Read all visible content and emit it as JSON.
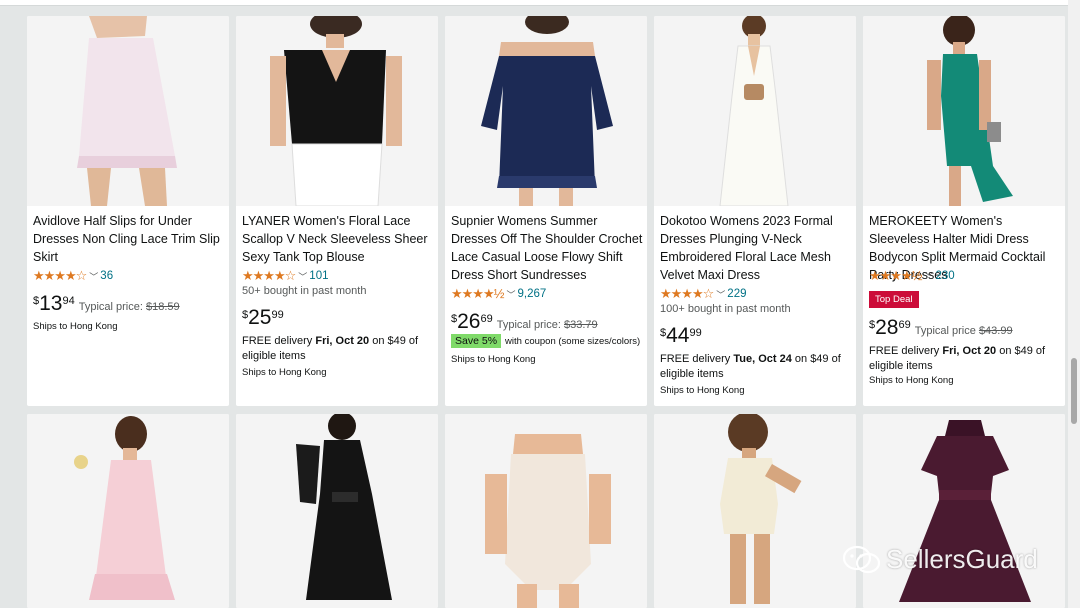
{
  "products_row1": [
    {
      "title": "Avidlove Half Slips for Under Dresses Non Cling Lace Trim Slip Skirt",
      "stars": "★★★★☆",
      "rating_count": "36",
      "price_symbol": "$",
      "price_whole": "13",
      "price_fraction": "94",
      "typical_label": "Typical price:",
      "typical_price": "$18.59",
      "ships": "Ships to Hong Kong"
    },
    {
      "title": "LYANER Women's Floral Lace Scallop V Neck Sleeveless Sheer Sexy Tank Top Blouse",
      "stars": "★★★★☆",
      "rating_count": "101",
      "bought": "50+ bought in past month",
      "price_symbol": "$",
      "price_whole": "25",
      "price_fraction": "99",
      "delivery_prefix": "FREE delivery ",
      "delivery_date": "Fri, Oct 20",
      "delivery_suffix": " on $49 of eligible items",
      "ships": "Ships to Hong Kong"
    },
    {
      "title": "Supnier Womens Summer Dresses Off The Shoulder Crochet Lace Casual Loose Flowy Shift Dress Short Sundresses",
      "stars": "★★★★½",
      "rating_count": "9,267",
      "price_symbol": "$",
      "price_whole": "26",
      "price_fraction": "69",
      "typical_label": "Typical price:",
      "typical_price": "$33.79",
      "save_badge": "Save 5%",
      "coupon_text": "with coupon (some sizes/colors)",
      "ships": "Ships to Hong Kong"
    },
    {
      "title": "Dokotoo Womens 2023 Formal Dresses Plunging V-Neck Embroidered Floral Lace Mesh Velvet Maxi Dress",
      "stars": "★★★★☆",
      "rating_count": "229",
      "bought": "100+ bought in past month",
      "price_symbol": "$",
      "price_whole": "44",
      "price_fraction": "99",
      "delivery_prefix": "FREE delivery ",
      "delivery_date": "Tue, Oct 24",
      "delivery_suffix": " on $49 of eligible items",
      "ships": "Ships to Hong Kong"
    },
    {
      "title": "MEROKEETY Women's Sleeveless Halter Midi Dress Bodycon Split Mermaid Cocktail Party Dresses",
      "stars": "★★★★½",
      "rating_count": "230",
      "badge": "Top Deal",
      "price_symbol": "$",
      "price_whole": "28",
      "price_fraction": "69",
      "typical_label": "Typical price",
      "typical_price": "$43.99",
      "delivery_prefix": "FREE delivery ",
      "delivery_date": "Fri, Oct 20",
      "delivery_suffix": " on $49 of eligible items",
      "ships": "Ships to Hong Kong"
    }
  ],
  "watermark": "SellersGuard",
  "icons": {
    "rating_chevron": "chevron-down-icon",
    "watermark_logo": "wechat-icon"
  },
  "colors": {
    "star": "#de7921",
    "link": "#007185",
    "save_badge": "#7fda69",
    "top_deal": "#cc0c39"
  }
}
